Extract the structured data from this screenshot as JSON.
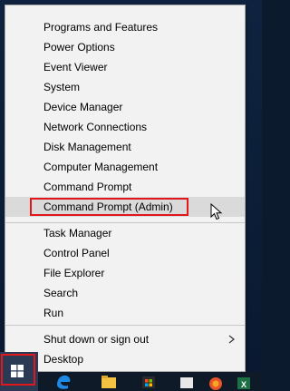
{
  "menu": {
    "items": [
      {
        "label": "Programs and Features"
      },
      {
        "label": "Power Options"
      },
      {
        "label": "Event Viewer"
      },
      {
        "label": "System"
      },
      {
        "label": "Device Manager"
      },
      {
        "label": "Network Connections"
      },
      {
        "label": "Disk Management"
      },
      {
        "label": "Computer Management"
      },
      {
        "label": "Command Prompt"
      },
      {
        "label": "Command Prompt (Admin)"
      },
      {
        "label": "Task Manager"
      },
      {
        "label": "Control Panel"
      },
      {
        "label": "File Explorer"
      },
      {
        "label": "Search"
      },
      {
        "label": "Run"
      },
      {
        "label": "Shut down or sign out"
      },
      {
        "label": "Desktop"
      }
    ],
    "hovered_item": "Command Prompt (Admin)",
    "submenu_arrow_icon": "chevron-right-icon"
  },
  "taskbar": {
    "start_icon": "windows-logo-icon",
    "icons": [
      "edge-browser-icon",
      "file-explorer-icon",
      "windows-store-icon",
      "app-icon",
      "browser-icon",
      "excel-icon"
    ]
  },
  "colors": {
    "menu_background": "#f2f2f2",
    "hover_background": "#dadada",
    "highlight_border": "#e0181b",
    "taskbar": "#0f1a29"
  }
}
